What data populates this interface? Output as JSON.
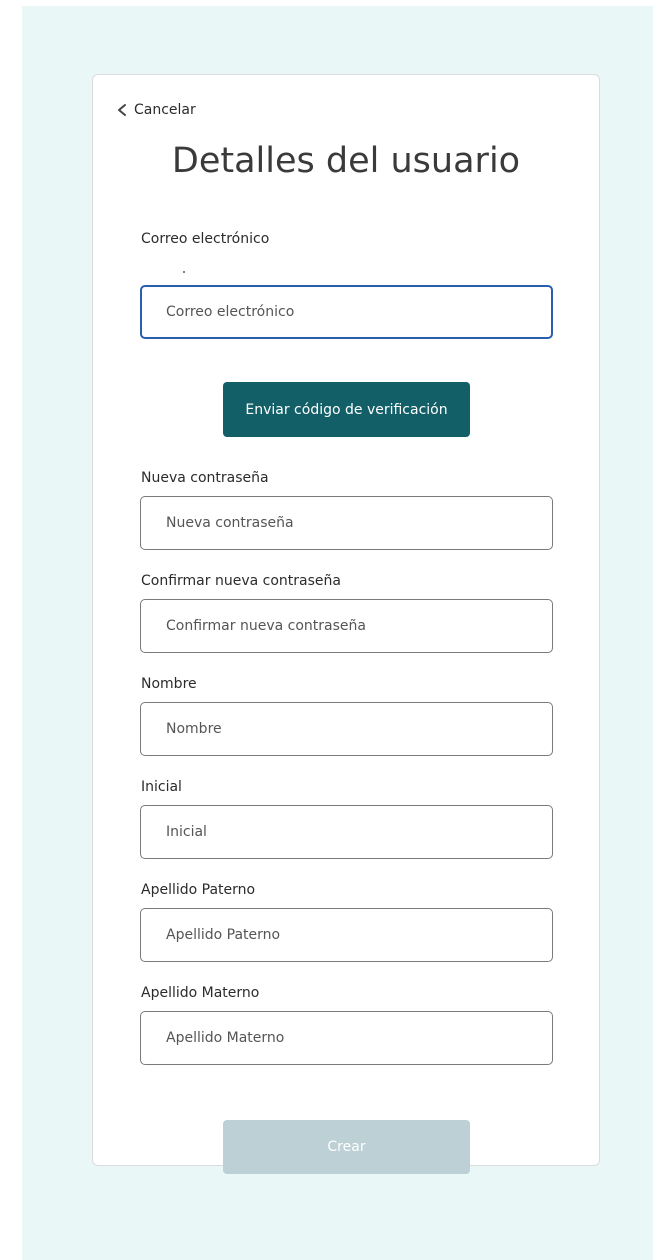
{
  "header": {
    "cancel_label": "Cancelar",
    "title": "Detalles del usuario"
  },
  "email": {
    "label": "Correo electrónico",
    "placeholder": "Correo electrónico",
    "value": ""
  },
  "send_code_button": "Enviar código de verificación",
  "fields": {
    "new_password": {
      "label": "Nueva contraseña",
      "placeholder": "Nueva contraseña"
    },
    "confirm_password": {
      "label": "Confirmar nueva contraseña",
      "placeholder": "Confirmar nueva contraseña"
    },
    "first_name": {
      "label": "Nombre",
      "placeholder": "Nombre"
    },
    "initial": {
      "label": "Inicial",
      "placeholder": "Inicial"
    },
    "paternal_surname": {
      "label": "Apellido Paterno",
      "placeholder": "Apellido Paterno"
    },
    "maternal_surname": {
      "label": "Apellido Materno",
      "placeholder": "Apellido Materno"
    }
  },
  "create_button": "Crear",
  "colors": {
    "primary": "#135f68",
    "disabled": "#bcd0d5",
    "focus": "#2a5fb0",
    "background": "#eaf7f7"
  },
  "icons": {
    "back": "chevron-left-icon"
  }
}
